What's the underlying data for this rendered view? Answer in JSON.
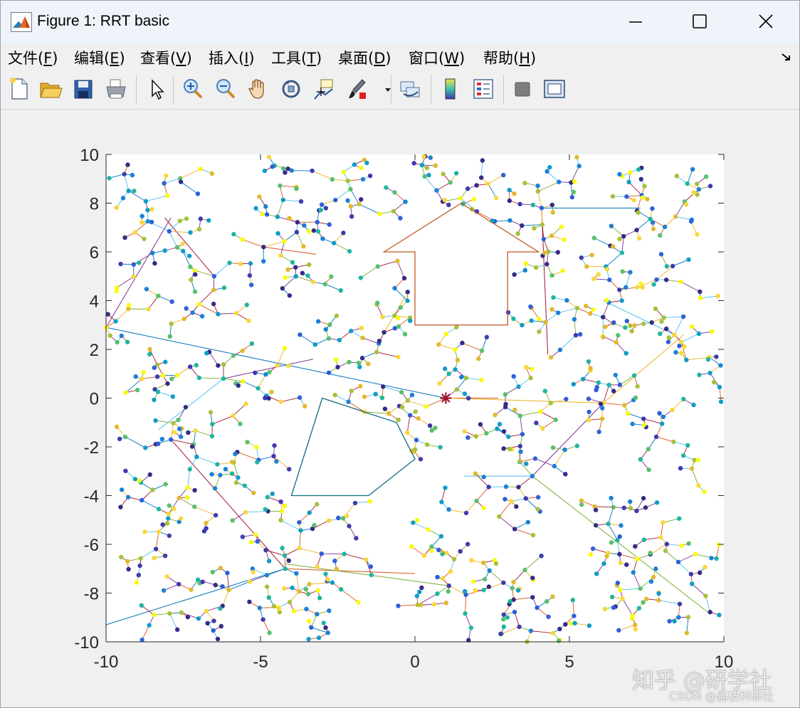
{
  "window": {
    "title": "Figure 1: RRT basic"
  },
  "menu": {
    "items": [
      {
        "label": "文件(",
        "key": "F",
        "end": ")"
      },
      {
        "label": "编辑(",
        "key": "E",
        "end": ")"
      },
      {
        "label": "查看(",
        "key": "V",
        "end": ")"
      },
      {
        "label": "插入(",
        "key": "I",
        "end": ")"
      },
      {
        "label": "工具(",
        "key": "T",
        "end": ")"
      },
      {
        "label": "桌面(",
        "key": "D",
        "end": ")"
      },
      {
        "label": "窗口(",
        "key": "W",
        "end": ")"
      },
      {
        "label": "帮助(",
        "key": "H",
        "end": ")"
      }
    ]
  },
  "toolbar": {
    "icons": [
      "new-file-icon",
      "open-folder-icon",
      "save-icon",
      "print-icon",
      "pointer-icon",
      "zoom-in-icon",
      "zoom-out-icon",
      "pan-hand-icon",
      "rotate-3d-icon",
      "data-cursor-icon",
      "brush-icon",
      "brush-dropdown-icon",
      "link-plot-icon",
      "colorbar-icon",
      "legend-icon",
      "hide-plot-tools-icon",
      "show-plot-tools-icon"
    ]
  },
  "watermark": {
    "zhihu": "知乎 @研学社",
    "csdn": "CSDN @荔枝科研社"
  },
  "chart_data": {
    "type": "scatter",
    "title": "",
    "xlabel": "",
    "ylabel": "",
    "xlim": [
      -10,
      10
    ],
    "ylim": [
      -10,
      10
    ],
    "xticks": [
      -10,
      -5,
      0,
      5,
      10
    ],
    "yticks": [
      -10,
      -8,
      -6,
      -4,
      -2,
      0,
      2,
      4,
      6,
      8,
      10
    ],
    "xtick_labels": [
      "-10",
      "-5",
      "0",
      "5",
      "10"
    ],
    "ytick_labels": [
      "-10",
      "-8",
      "-6",
      "-4",
      "-2",
      "0",
      "2",
      "4",
      "6",
      "8",
      "10"
    ],
    "grid": false,
    "start_marker": {
      "x": 1,
      "y": 0,
      "marker": "*",
      "color": "#a2142f"
    },
    "obstacles": [
      {
        "name": "polygon",
        "color": "#0e6b80",
        "points": [
          [
            -3,
            0
          ],
          [
            -0.6,
            -1
          ],
          [
            0,
            -2.5
          ],
          [
            -1.5,
            -4
          ],
          [
            -4,
            -4
          ]
        ]
      },
      {
        "name": "arrow",
        "color": "#c05820",
        "points": [
          [
            -1,
            6
          ],
          [
            1.5,
            8
          ],
          [
            4,
            6
          ],
          [
            3,
            6
          ],
          [
            3,
            3
          ],
          [
            0,
            3
          ],
          [
            0,
            6
          ]
        ]
      }
    ],
    "tree_hubs": [
      {
        "x": 1,
        "y": 0
      },
      {
        "x": -10,
        "y": 2.9
      },
      {
        "x": -6.2,
        "y": 0.8
      },
      {
        "x": -4.2,
        "y": -7
      },
      {
        "x": 6.1,
        "y": -0.2
      },
      {
        "x": 3.8,
        "y": -3.2
      },
      {
        "x": 4.1,
        "y": 7.8
      },
      {
        "x": -1,
        "y": 2.7
      },
      {
        "x": -7.9,
        "y": -1.7
      },
      {
        "x": -4.9,
        "y": 6.2
      },
      {
        "x": 8.4,
        "y": 2.6
      },
      {
        "x": -6.5,
        "y": 5
      },
      {
        "x": 6.7,
        "y": 4
      },
      {
        "x": 1.1,
        "y": -7.7
      },
      {
        "x": 7.2,
        "y": -6.6
      }
    ],
    "tree_long_edges": [
      [
        [
          1,
          0
        ],
        [
          -10,
          2.9
        ]
      ],
      [
        [
          1,
          0
        ],
        [
          2.7,
          0
        ]
      ],
      [
        [
          1,
          0
        ],
        [
          6.1,
          -0.2
        ]
      ],
      [
        [
          -10,
          2.9
        ],
        [
          -7.9,
          7.4
        ]
      ],
      [
        [
          -10,
          2.9
        ],
        [
          -10,
          0.4
        ]
      ],
      [
        [
          -6.2,
          0.8
        ],
        [
          -8.3,
          -1.3
        ]
      ],
      [
        [
          -7.9,
          -1.7
        ],
        [
          -4.2,
          -7
        ]
      ],
      [
        [
          -4.2,
          -7
        ],
        [
          -10,
          -9.3
        ]
      ],
      [
        [
          -4.2,
          -7
        ],
        [
          0,
          -7.2
        ]
      ],
      [
        [
          6.1,
          -0.2
        ],
        [
          8.7,
          2.6
        ]
      ],
      [
        [
          6.1,
          -0.2
        ],
        [
          3.8,
          -3.2
        ]
      ],
      [
        [
          3.8,
          -3.2
        ],
        [
          9.5,
          -8.8
        ]
      ],
      [
        [
          3.8,
          -3.2
        ],
        [
          1.6,
          -3.2
        ]
      ],
      [
        [
          4.1,
          7.8
        ],
        [
          4.3,
          1.8
        ]
      ],
      [
        [
          4.1,
          7.8
        ],
        [
          7.3,
          7.8
        ]
      ],
      [
        [
          -4.9,
          6.2
        ],
        [
          -3.2,
          5.9
        ]
      ],
      [
        [
          -1,
          2.7
        ],
        [
          -0.3,
          4.2
        ]
      ],
      [
        [
          -6.2,
          0.8
        ],
        [
          -3.3,
          1.6
        ]
      ],
      [
        [
          1.1,
          -7.7
        ],
        [
          -4.2,
          -6.8
        ]
      ],
      [
        [
          8.4,
          2.6
        ],
        [
          6.1,
          4
        ]
      ],
      [
        [
          -6.5,
          5
        ],
        [
          -8.1,
          7.4
        ]
      ]
    ],
    "tree_node_count": 1000,
    "node_colormap": "parula"
  }
}
